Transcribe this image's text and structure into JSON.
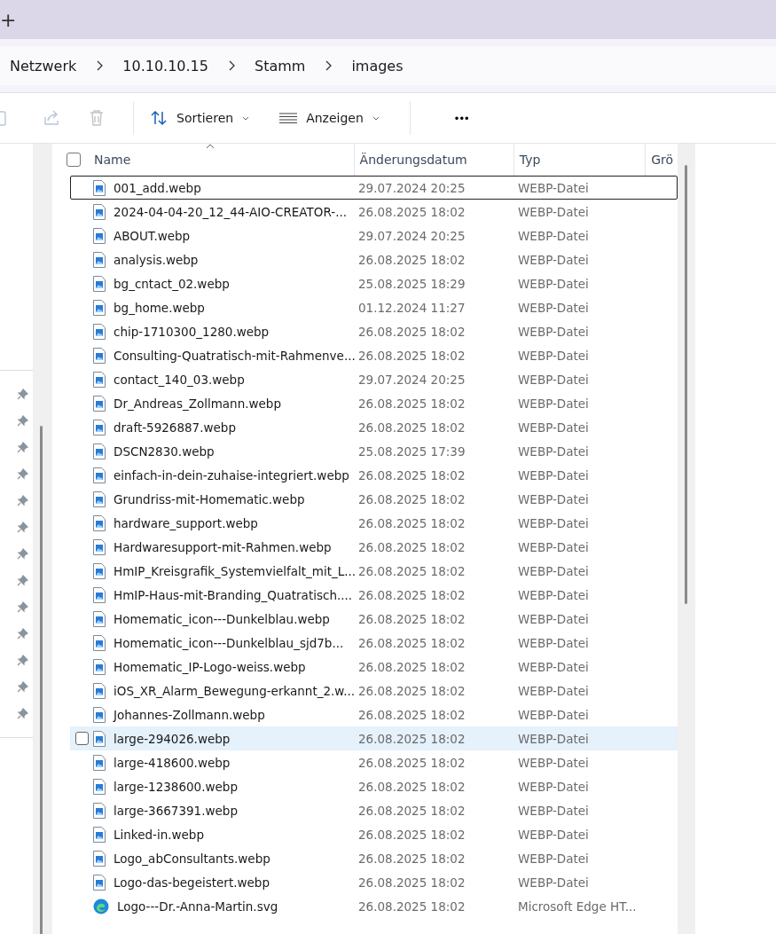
{
  "tab_bar": {
    "new_tab": "+"
  },
  "breadcrumb": [
    {
      "label": "Netzwerk"
    },
    {
      "label": "10.10.10.15"
    },
    {
      "label": "Stamm"
    },
    {
      "label": "images"
    }
  ],
  "toolbar": {
    "sort": "Sortieren",
    "view": "Anzeigen",
    "more": "•••"
  },
  "select_all": {
    "checked": false
  },
  "columns": [
    {
      "label": "Name"
    },
    {
      "label": "Änderungsdatum"
    },
    {
      "label": "Typ"
    },
    {
      "label": "Grö"
    }
  ],
  "rows": [
    {
      "name": "001_add.webp",
      "date": "29.07.2024 20:25",
      "type": "WEBP-Datei",
      "kind": "image",
      "focused": true,
      "selected": false
    },
    {
      "name": "2024-04-04-20_12_44-AIO-CREATOR-...",
      "date": "26.08.2025 18:02",
      "type": "WEBP-Datei",
      "kind": "image",
      "focused": false,
      "selected": false
    },
    {
      "name": "ABOUT.webp",
      "date": "29.07.2024 20:25",
      "type": "WEBP-Datei",
      "kind": "image",
      "focused": false,
      "selected": false
    },
    {
      "name": "analysis.webp",
      "date": "26.08.2025 18:02",
      "type": "WEBP-Datei",
      "kind": "image",
      "focused": false,
      "selected": false
    },
    {
      "name": "bg_cntact_02.webp",
      "date": "25.08.2025 18:29",
      "type": "WEBP-Datei",
      "kind": "image",
      "focused": false,
      "selected": false
    },
    {
      "name": "bg_home.webp",
      "date": "01.12.2024 11:27",
      "type": "WEBP-Datei",
      "kind": "image",
      "focused": false,
      "selected": false
    },
    {
      "name": "chip-1710300_1280.webp",
      "date": "26.08.2025 18:02",
      "type": "WEBP-Datei",
      "kind": "image",
      "focused": false,
      "selected": false
    },
    {
      "name": "Consulting-Quatratisch-mit-Rahmenve...",
      "date": "26.08.2025 18:02",
      "type": "WEBP-Datei",
      "kind": "image",
      "focused": false,
      "selected": false
    },
    {
      "name": "contact_140_03.webp",
      "date": "29.07.2024 20:25",
      "type": "WEBP-Datei",
      "kind": "image",
      "focused": false,
      "selected": false
    },
    {
      "name": "Dr_Andreas_Zollmann.webp",
      "date": "26.08.2025 18:02",
      "type": "WEBP-Datei",
      "kind": "image",
      "focused": false,
      "selected": false
    },
    {
      "name": "draft-5926887.webp",
      "date": "26.08.2025 18:02",
      "type": "WEBP-Datei",
      "kind": "image",
      "focused": false,
      "selected": false
    },
    {
      "name": "DSCN2830.webp",
      "date": "25.08.2025 17:39",
      "type": "WEBP-Datei",
      "kind": "image",
      "focused": false,
      "selected": false
    },
    {
      "name": "einfach-in-dein-zuhaise-integriert.webp",
      "date": "26.08.2025 18:02",
      "type": "WEBP-Datei",
      "kind": "image",
      "focused": false,
      "selected": false
    },
    {
      "name": "Grundriss-mit-Homematic.webp",
      "date": "26.08.2025 18:02",
      "type": "WEBP-Datei",
      "kind": "image",
      "focused": false,
      "selected": false
    },
    {
      "name": "hardware_support.webp",
      "date": "26.08.2025 18:02",
      "type": "WEBP-Datei",
      "kind": "image",
      "focused": false,
      "selected": false
    },
    {
      "name": "Hardwaresupport-mit-Rahmen.webp",
      "date": "26.08.2025 18:02",
      "type": "WEBP-Datei",
      "kind": "image",
      "focused": false,
      "selected": false
    },
    {
      "name": "HmIP_Kreisgrafik_Systemvielfalt_mit_L...",
      "date": "26.08.2025 18:02",
      "type": "WEBP-Datei",
      "kind": "image",
      "focused": false,
      "selected": false
    },
    {
      "name": "HmIP-Haus-mit-Branding_Quatratisch....",
      "date": "26.08.2025 18:02",
      "type": "WEBP-Datei",
      "kind": "image",
      "focused": false,
      "selected": false
    },
    {
      "name": "Homematic_icon---Dunkelblau.webp",
      "date": "26.08.2025 18:02",
      "type": "WEBP-Datei",
      "kind": "image",
      "focused": false,
      "selected": false
    },
    {
      "name": "Homematic_icon---Dunkelblau_sjd7b...",
      "date": "26.08.2025 18:02",
      "type": "WEBP-Datei",
      "kind": "image",
      "focused": false,
      "selected": false
    },
    {
      "name": "Homematic_IP-Logo-weiss.webp",
      "date": "26.08.2025 18:02",
      "type": "WEBP-Datei",
      "kind": "image",
      "focused": false,
      "selected": false
    },
    {
      "name": "iOS_XR_Alarm_Bewegung-erkannt_2.w...",
      "date": "26.08.2025 18:02",
      "type": "WEBP-Datei",
      "kind": "image",
      "focused": false,
      "selected": false
    },
    {
      "name": "Johannes-Zollmann.webp",
      "date": "26.08.2025 18:02",
      "type": "WEBP-Datei",
      "kind": "image",
      "focused": false,
      "selected": false
    },
    {
      "name": "large-294026.webp",
      "date": "26.08.2025 18:02",
      "type": "WEBP-Datei",
      "kind": "image",
      "focused": false,
      "selected": true
    },
    {
      "name": "large-418600.webp",
      "date": "26.08.2025 18:02",
      "type": "WEBP-Datei",
      "kind": "image",
      "focused": false,
      "selected": false
    },
    {
      "name": "large-1238600.webp",
      "date": "26.08.2025 18:02",
      "type": "WEBP-Datei",
      "kind": "image",
      "focused": false,
      "selected": false
    },
    {
      "name": "large-3667391.webp",
      "date": "26.08.2025 18:02",
      "type": "WEBP-Datei",
      "kind": "image",
      "focused": false,
      "selected": false
    },
    {
      "name": "Linked-in.webp",
      "date": "26.08.2025 18:02",
      "type": "WEBP-Datei",
      "kind": "image",
      "focused": false,
      "selected": false
    },
    {
      "name": "Logo_abConsultants.webp",
      "date": "26.08.2025 18:02",
      "type": "WEBP-Datei",
      "kind": "image",
      "focused": false,
      "selected": false
    },
    {
      "name": "Logo-das-begeistert.webp",
      "date": "26.08.2025 18:02",
      "type": "WEBP-Datei",
      "kind": "image",
      "focused": false,
      "selected": false
    },
    {
      "name": "Logo---Dr.-Anna-Martin.svg",
      "date": "26.08.2025 18:02",
      "type": "Microsoft Edge HT...",
      "kind": "edge",
      "focused": false,
      "selected": false
    }
  ]
}
